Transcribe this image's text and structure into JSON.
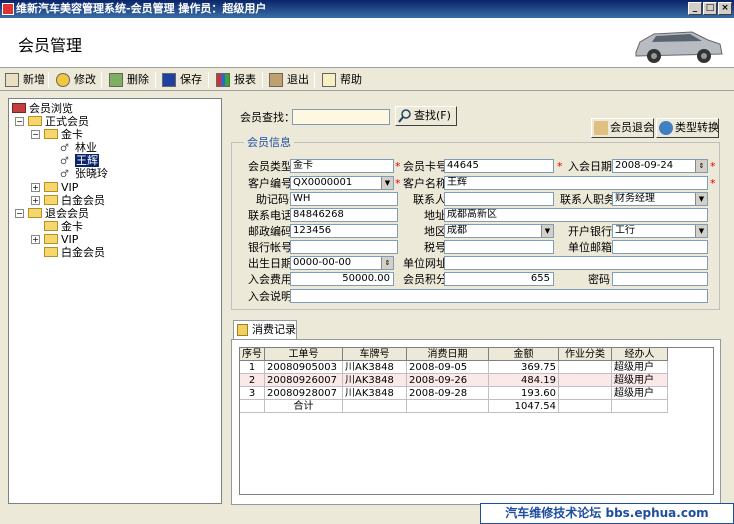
{
  "window": {
    "title": "维新汽车美容管理系统-会员管理   操作员：超级用户",
    "minimize": "_",
    "maximize": "□",
    "close": "×"
  },
  "header": {
    "title": "会员管理"
  },
  "toolbar": {
    "add": "新增",
    "edit": "修改",
    "delete": "删除",
    "save": "保存",
    "report": "报表",
    "exit": "退出",
    "help": "帮助"
  },
  "tree": {
    "root": "会员浏览",
    "regular": "正式会员",
    "gold": "金卡",
    "m1": "林业",
    "m2": "王辉",
    "m3": "张晓玲",
    "vip": "VIP",
    "platinum": "白金会员",
    "retired": "退会会员",
    "r_gold": "金卡",
    "r_vip": "VIP",
    "r_platinum": "白金会员"
  },
  "search": {
    "label": "会员查找：",
    "value": "",
    "button": "查找(F)"
  },
  "actions": {
    "withdraw": "会员退会",
    "convert": "类型转换"
  },
  "info": {
    "group_title": "会员信息",
    "type_label": "会员类型",
    "type_value": "金卡",
    "card_label": "会员卡号",
    "card_value": "44645",
    "join_date_label": "入会日期",
    "join_date_value": "2008-09-24",
    "cust_no_label": "客户编号",
    "cust_no_value": "QX0000001",
    "cust_name_label": "客户名称",
    "cust_name_value": "王辉",
    "memo_label": "助记码",
    "memo_value": "WH",
    "contact_label": "联系人",
    "contact_value": "",
    "contact_title_label": "联系人职务",
    "contact_title_value": "财务经理",
    "phone_label": "联系电话",
    "phone_value": "84846268",
    "address_label": "地址",
    "address_value": "成都高新区",
    "zip_label": "邮政编码",
    "zip_value": "123456",
    "region_label": "地区",
    "region_value": "成都",
    "bank_label": "开户银行",
    "bank_value": "工行",
    "account_label": "银行帐号",
    "account_value": "",
    "tax_label": "税号",
    "tax_value": "",
    "email_label": "单位邮箱",
    "email_value": "",
    "birth_label": "出生日期",
    "birth_value": "0000-00-00",
    "website_label": "单位网址",
    "website_value": "",
    "fee_label": "入会费用",
    "fee_value": "50000.00",
    "points_label": "会员积分",
    "points_value": "655",
    "password_label": "密码",
    "password_value": "",
    "note_label": "入会说明",
    "note_value": "",
    "required_mark": "*"
  },
  "tab": {
    "label": "消费记录"
  },
  "grid": {
    "headers": [
      "序号",
      "工单号",
      "车牌号",
      "消费日期",
      "金额",
      "作业分类",
      "经办人"
    ],
    "rows": [
      [
        "1",
        "20080905003",
        "川AK3848",
        "2008-09-05",
        "369.75",
        "",
        "超级用户"
      ],
      [
        "2",
        "20080926007",
        "川AK3848",
        "2008-09-26",
        "484.19",
        "",
        "超级用户"
      ],
      [
        "3",
        "20080928007",
        "川AK3848",
        "2008-09-28",
        "193.60",
        "",
        "超级用户"
      ]
    ],
    "total_label": "合计",
    "total_value": "1047.54"
  },
  "footer": {
    "text": "汽车维修技术论坛 bbs.ephua.com"
  }
}
